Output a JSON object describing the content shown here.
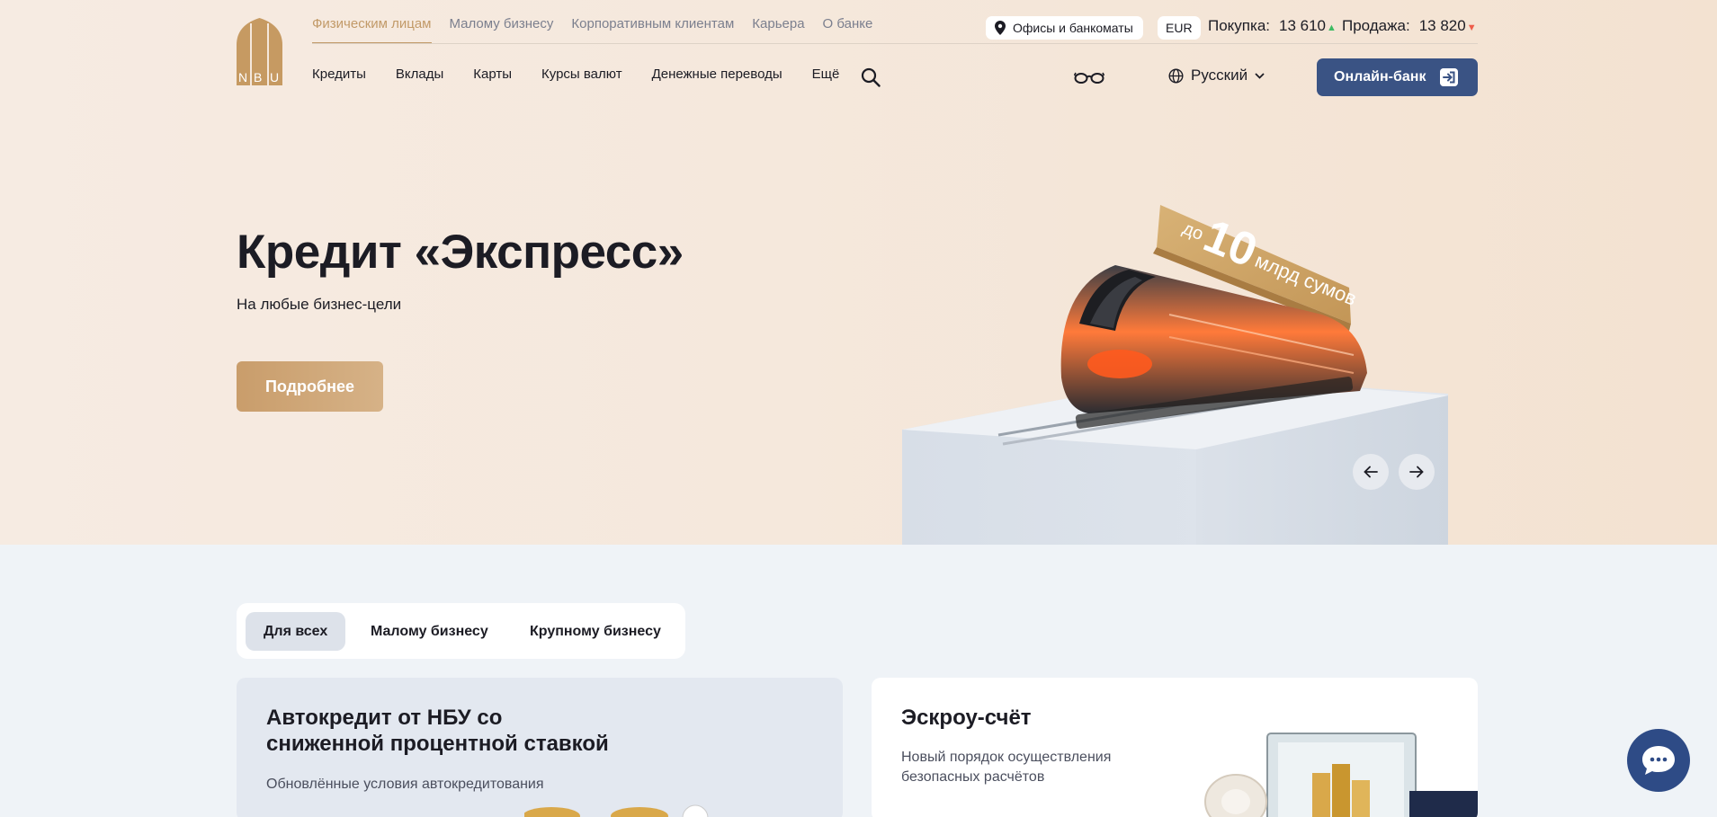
{
  "brand": {
    "logo_text": "NBU",
    "accent": "#c29a68",
    "primary": "#3a5384"
  },
  "topnav": {
    "items": [
      "Физическим лицам",
      "Малому бизнесу",
      "Корпоративным клиентам",
      "Карьера",
      "О банке"
    ]
  },
  "header": {
    "offices_label": "Офисы и банкоматы",
    "currency": "EUR",
    "buy_label": "Покупка:",
    "buy_value": "13 610",
    "buy_trend": "▲",
    "sell_label": "Продажа:",
    "sell_value": "13 820",
    "sell_trend": "▼"
  },
  "mainnav": {
    "items": [
      "Кредиты",
      "Вклады",
      "Карты",
      "Курсы валют",
      "Денежные переводы",
      "Ещё"
    ],
    "language": "Русский",
    "online_bank": "Онлайн-банк"
  },
  "hero": {
    "title": "Кредит «Экспресс»",
    "subtitle": "На любые бизнес-цели",
    "button": "Подробнее",
    "badge_prefix": "до",
    "badge_number": "10",
    "badge_suffix": "млрд сумов"
  },
  "tabs": {
    "items": [
      "Для всех",
      "Малому бизнесу",
      "Крупному бизнесу"
    ]
  },
  "cards": [
    {
      "title_line1": "Автокредит от НБУ со",
      "title_line2": "сниженной процентной ставкой",
      "text": "Обновлённые условия автокредитования"
    },
    {
      "title": "Эскроу-счёт",
      "text_line1": "Новый порядок осуществления",
      "text_line2": "безопасных расчётов"
    }
  ]
}
